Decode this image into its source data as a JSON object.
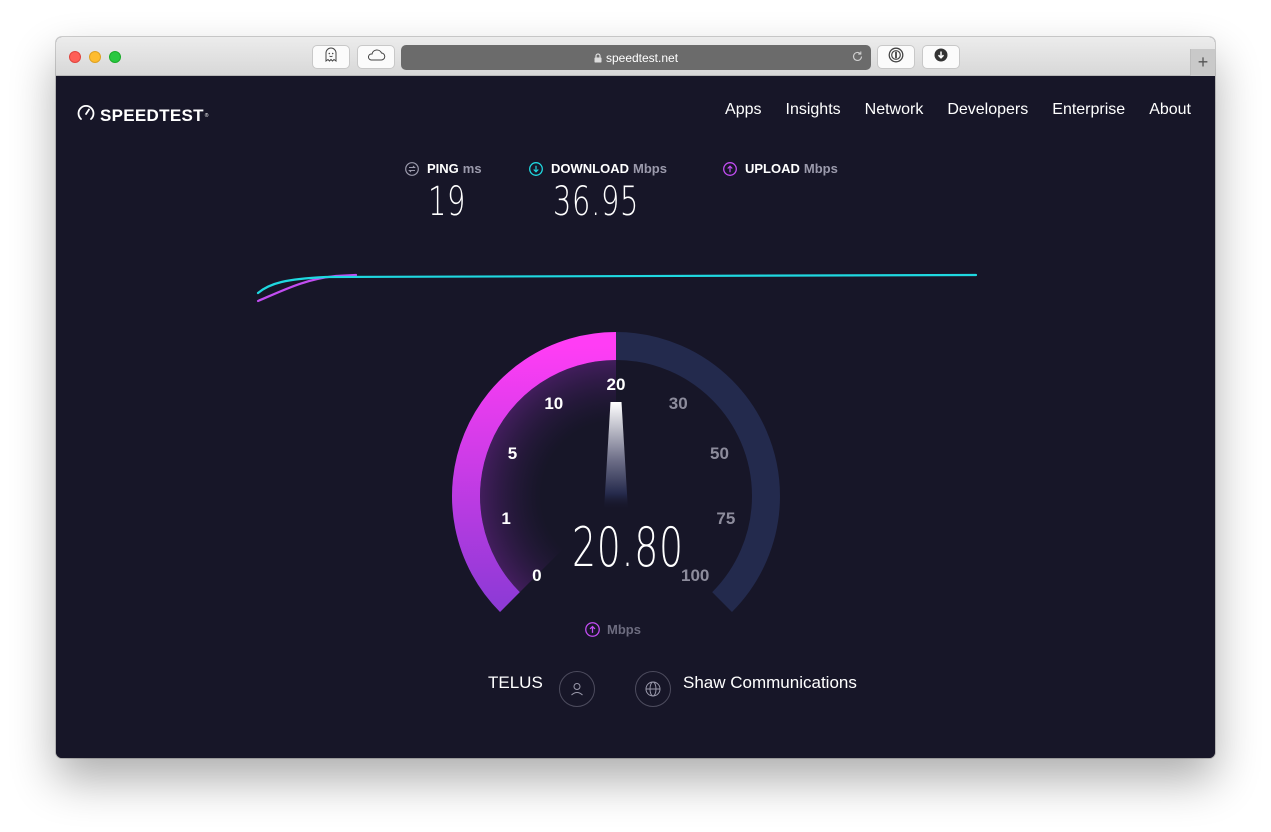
{
  "browser": {
    "url": "speedtest.net",
    "toolbar_icons": [
      "ghost-icon",
      "cloud-icon",
      "onepassword-icon",
      "download-icon"
    ],
    "new_tab_label": "+"
  },
  "header": {
    "logo_text": "SPEEDTEST",
    "logo_tm": "®",
    "nav": [
      "Apps",
      "Insights",
      "Network",
      "Developers",
      "Enterprise",
      "About"
    ]
  },
  "metrics": {
    "ping": {
      "label": "PING",
      "unit": "ms",
      "value": "19"
    },
    "download": {
      "label": "DOWNLOAD",
      "unit": "Mbps",
      "value": "36.95"
    },
    "upload": {
      "label": "UPLOAD",
      "unit": "Mbps",
      "value": ""
    }
  },
  "gauge": {
    "scale_labels": [
      "0",
      "1",
      "5",
      "10",
      "20",
      "30",
      "50",
      "75",
      "100"
    ],
    "current_speed": "20.80",
    "unit": "Mbps",
    "fill_fraction": 0.5,
    "colors": {
      "fill_start": "#8e3ad6",
      "fill_end": "#ff3df5",
      "track": "#232a4d",
      "active_label": "#ffffff",
      "inactive_label": "#8d8c9c"
    }
  },
  "graph": {
    "download_color": "#1fd8e0",
    "upload_color": "#c24df2"
  },
  "connection": {
    "isp": "TELUS",
    "server": "Shaw Communications"
  }
}
